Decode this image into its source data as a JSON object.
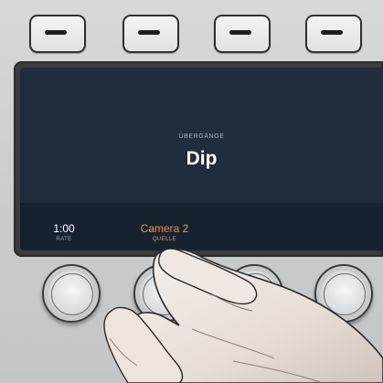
{
  "display": {
    "section_label": "ÜBERGÄNGE",
    "transition_name": "Dip",
    "params": [
      {
        "value": "1:00",
        "label": "RATE"
      },
      {
        "value": "Camera 2",
        "label": "QUELLE"
      }
    ]
  },
  "colors": {
    "screen_background": "#1f2d3c",
    "source_accent": "#f0913a",
    "panel": "#cbcdcf"
  },
  "icons": {
    "soft_buttons": [
      "minus-bar-icon",
      "minus-bar-icon",
      "minus-bar-icon",
      "minus-bar-icon"
    ]
  }
}
